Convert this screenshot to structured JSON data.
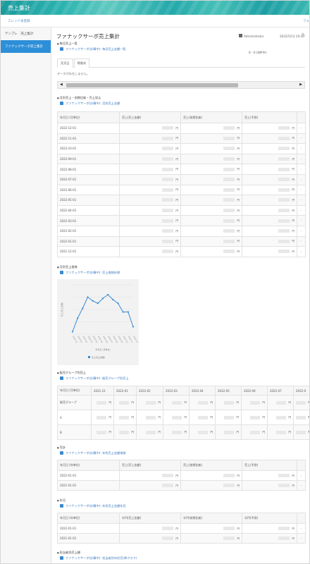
{
  "app": {
    "title": "売上集計"
  },
  "thread": {
    "left": "スレッド未登録",
    "right": "フォ"
  },
  "sidebar": {
    "items": [
      {
        "label": "テンプレ　売上集計"
      },
      {
        "label": "ファナックサーボ売上集計"
      }
    ]
  },
  "page": {
    "title": "ファナックサーボ売上集計",
    "user": "Administrator",
    "datetime": "2022/5/13 10:40",
    "range": "0 - 0 (0件中)"
  },
  "sections": {
    "s1": {
      "title": "毎月売上一覧",
      "link": "ファナックサーボ(計算中): 毎月売上金額一覧"
    },
    "tabs": [
      "売月日",
      "得意先"
    ],
    "nodata": "データが存在しません。",
    "s2": {
      "title": "月別売上・前期比較・売上見込",
      "link": "ファナックサーボ(計算中): 月別売上金額"
    },
    "s3": {
      "title": "月別売上推移",
      "link": "ファナックサーボ(計算中): 売上推移折線"
    },
    "s4": {
      "title": "販売グループ別売上",
      "link": "ファナックサーボ(計算中): 販売グループ別売上"
    },
    "s5": {
      "title": "売計",
      "link": "ファナックサーボ(計算中): 年別売上金額推移"
    },
    "s6": {
      "title": "年月",
      "link": "ファナックサーボ(計算中): 年別売上金額年月"
    },
    "s7": {
      "title": "担当者別売上額",
      "link": "ファナックサーボ(計算中): 担当者別年別売(棒グラフ)"
    }
  },
  "monthly_table": {
    "headers": [
      "年月日 (月単位)",
      "売上(売上金額)",
      "売上(前期比較)",
      "売上(予測)"
    ],
    "yen": "円",
    "rows": [
      "2022-12-01",
      "2022-11-01",
      "2022-10-01",
      "2022-09-01",
      "2022-08-01",
      "2022-07-01",
      "2022-06-01",
      "2022-05-01",
      "2022-04-01",
      "2022-03-01",
      "2022-02-01",
      "2022-01-01",
      "2021-12-01"
    ]
  },
  "chart_data": {
    "type": "line",
    "title": "",
    "xlabel": "年月日 (月単位)",
    "ylabel": "売上(売上金額)",
    "legend": "売上(売上金額)",
    "x": [
      "2021-12",
      "2022-01",
      "2022-02",
      "2022-03",
      "2022-04",
      "2022-05",
      "2022-06",
      "2022-07",
      "2022-08",
      "2022-09",
      "2022-10",
      "2022-11",
      "2022-12"
    ],
    "values": [
      2,
      13,
      21,
      30,
      27,
      25,
      29,
      32,
      28,
      25,
      18,
      18,
      6
    ],
    "ylim": [
      0,
      40
    ],
    "color": "#3a8ad3"
  },
  "group_table": {
    "headers": [
      "年月日 (月単位)",
      "2021-12",
      "2022-01",
      "2022-02",
      "2022-03",
      "2022-04",
      "2022-05",
      "2022-06",
      "2022-07",
      "2022-0"
    ],
    "rows": [
      "販売グループ",
      "A",
      "B"
    ],
    "yen": "円"
  },
  "year_table1": {
    "headers": [
      "年月日 (年単位)",
      "売上(売上金額)",
      "売上(前期比較)",
      "売上(予測)"
    ],
    "rows": [
      "2022-01-01",
      "2021-01-01"
    ],
    "yen": "円"
  },
  "year_table2": {
    "headers": [
      "年月日 (年単位)",
      "半円(売上金額)",
      "半円(前期比較)",
      "半円(予測)"
    ],
    "rows": [
      "2022-01-01",
      "2021-01-01"
    ],
    "yen": "円"
  }
}
